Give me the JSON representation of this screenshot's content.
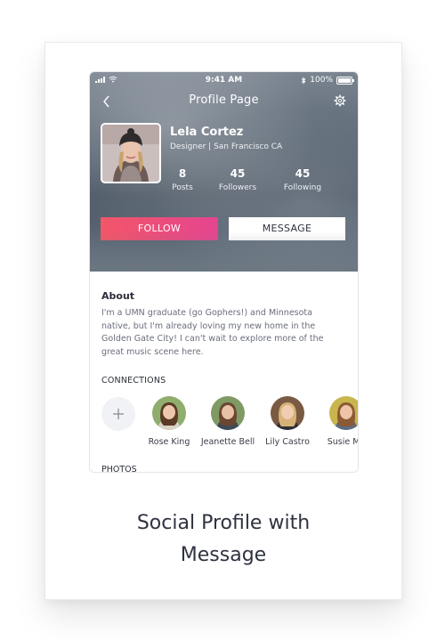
{
  "status_bar": {
    "time": "9:41 AM",
    "battery": "100%"
  },
  "nav": {
    "title": "Profile Page"
  },
  "profile": {
    "name": "Lela Cortez",
    "subtitle": "Designer | San Francisco CA",
    "stats": [
      {
        "value": "8",
        "label": "Posts"
      },
      {
        "value": "45",
        "label": "Followers"
      },
      {
        "value": "45",
        "label": "Following"
      }
    ]
  },
  "actions": {
    "follow": "FOLLOW",
    "message": "MESSAGE"
  },
  "about": {
    "title": "About",
    "text": "I'm a UMN graduate (go Gophers!) and Minnesota native, but I'm already loving my new home in the Golden Gate City! I can't wait to explore more of the great music scene here."
  },
  "connections": {
    "title": "CONNECTIONS",
    "items": [
      {
        "name": "Rose King"
      },
      {
        "name": "Jeanette Bell"
      },
      {
        "name": "Lily Castro"
      },
      {
        "name": "Susie Mo"
      }
    ]
  },
  "photos": {
    "title": "PHOTOS"
  },
  "caption": {
    "line1": "Social Profile with",
    "line2": "Message"
  },
  "colors": {
    "follow_gradient_start": "#f25668",
    "follow_gradient_end": "#e44590",
    "text_dark": "#2f3340"
  }
}
